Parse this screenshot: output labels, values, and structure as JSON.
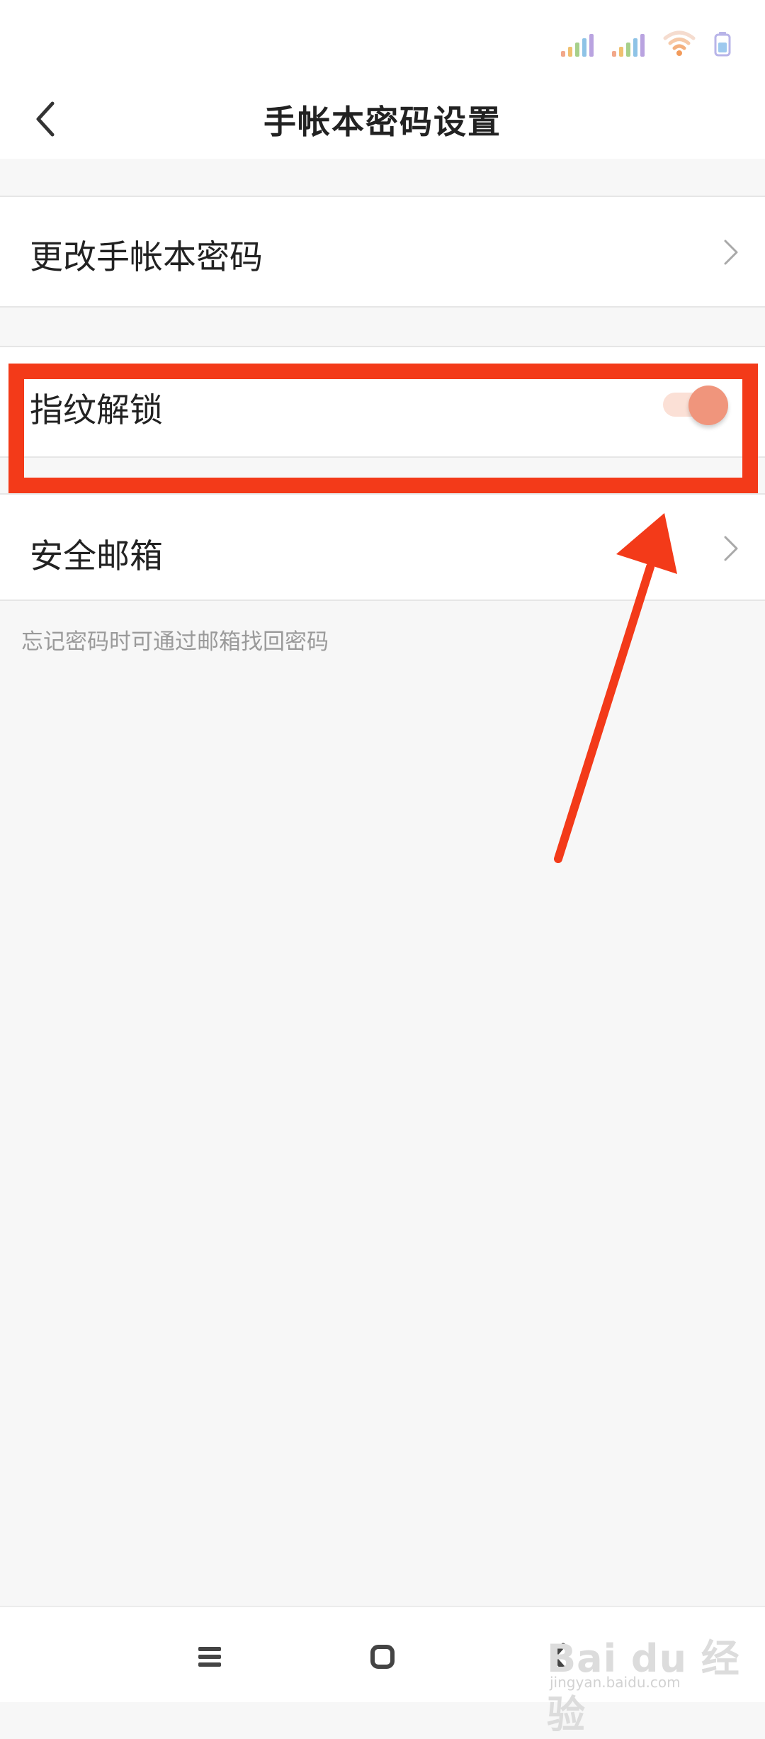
{
  "header": {
    "title": "手帐本密码设置"
  },
  "settings": {
    "change_password": {
      "label": "更改手帐本密码"
    },
    "fingerprint_unlock": {
      "label": "指纹解锁",
      "enabled": true
    },
    "security_email": {
      "label": "安全邮箱",
      "hint": "忘记密码时可通过邮箱找回密码"
    }
  },
  "watermark": {
    "brand": "Bai du 经验",
    "url": "jingyan.baidu.com"
  },
  "colors": {
    "annotation_red": "#f33a19",
    "toggle_on": "#f0957c",
    "toggle_track": "#fbe0d6"
  }
}
